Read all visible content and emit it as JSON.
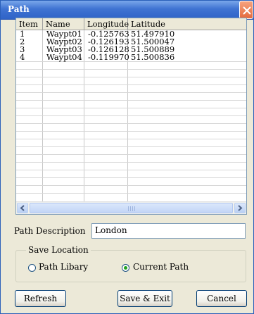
{
  "window": {
    "title": "Path",
    "close_glyph": "✕"
  },
  "grid": {
    "columns": [
      "Item",
      "Name",
      "Longitude",
      "Latitude"
    ],
    "rows": [
      [
        "1",
        "Waypt01",
        "-0.125763",
        "51.497910"
      ],
      [
        "2",
        "Waypt02",
        "-0.126193",
        "51.500047"
      ],
      [
        "3",
        "Waypt03",
        "-0.126128",
        "51.500889"
      ],
      [
        "4",
        "Waypt04",
        "-0.119970",
        "51.500836"
      ]
    ]
  },
  "description": {
    "label": "Path Description",
    "value": "London"
  },
  "save_location": {
    "legend": "Save Location",
    "options": [
      {
        "label": "Path Libary",
        "selected": false
      },
      {
        "label": "Current Path",
        "selected": true
      }
    ]
  },
  "buttons": {
    "refresh": "Refresh",
    "save_exit": "Save & Exit",
    "cancel": "Cancel"
  },
  "icons": {
    "close": "close-icon",
    "scroll_left": "arrow-left-icon",
    "scroll_right": "arrow-right-icon"
  },
  "colors": {
    "titlebar": "#3f73d2",
    "dialog_bg": "#ece9d8",
    "close_button": "#e46a3d",
    "radio_selected": "#21a121"
  }
}
